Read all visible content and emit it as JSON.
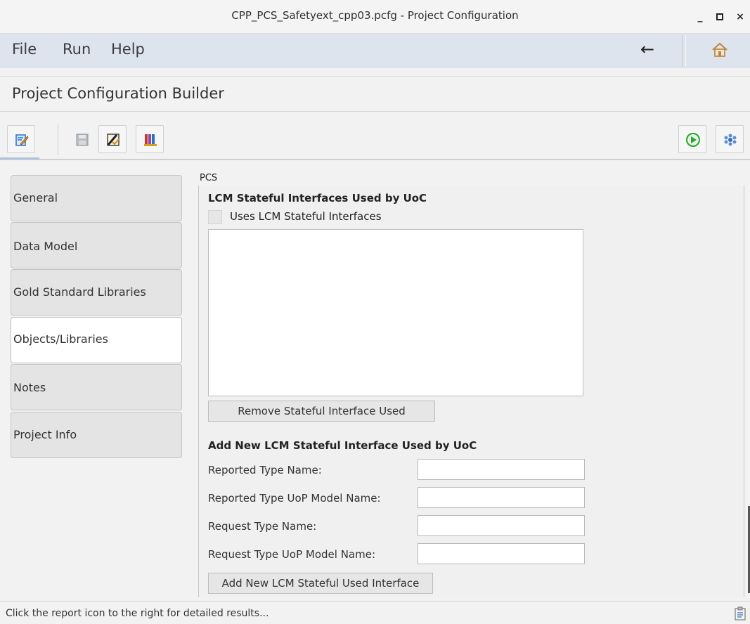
{
  "window": {
    "title": "CPP_PCS_Safetyext_cpp03.pcfg - Project Configuration",
    "minimize": "_",
    "maximize": "□",
    "close": "×"
  },
  "menu": {
    "file": "File",
    "run": "Run",
    "help": "Help",
    "back_icon": "←"
  },
  "page_title": "Project Configuration Builder",
  "toolbar": {
    "icons": [
      "edit-config-icon",
      "save-icon",
      "validate-icon",
      "report-books-icon",
      "run-icon",
      "settings-snowflake-icon"
    ],
    "colors": {
      "run": "#2aa52a",
      "edit": "#2a6fc9",
      "books": "#c0392b"
    }
  },
  "sidebar": {
    "tabs": [
      {
        "label": "General",
        "active": false
      },
      {
        "label": "Data Model",
        "active": false
      },
      {
        "label": "Gold Standard Libraries",
        "active": false
      },
      {
        "label": "Objects/Libraries",
        "active": true
      },
      {
        "label": "Notes",
        "active": false
      },
      {
        "label": "Project Info",
        "active": false
      }
    ]
  },
  "panel": {
    "label": "PCS",
    "section_title": "LCM Stateful Interfaces Used by UoC",
    "checkbox_label": "Uses LCM Stateful Interfaces",
    "checkbox_checked": false,
    "remove_button": "Remove Stateful Interface Used",
    "add_section_title": "Add New LCM Stateful Interface Used by UoC",
    "fields": [
      {
        "label": "Reported Type Name:",
        "value": ""
      },
      {
        "label": "Reported Type UoP Model Name:",
        "value": ""
      },
      {
        "label": "Request Type Name:",
        "value": ""
      },
      {
        "label": "Request Type UoP Model Name:",
        "value": ""
      }
    ],
    "add_button": "Add New LCM Stateful Used Interface"
  },
  "status": {
    "text": "Click the report icon to the right for detailed results..."
  }
}
